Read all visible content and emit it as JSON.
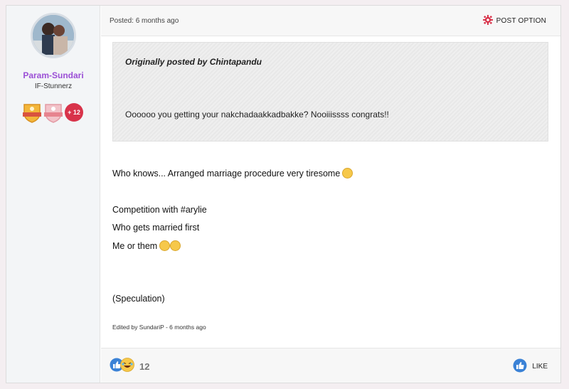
{
  "user": {
    "name": "Param-Sundari",
    "title": "IF-Stunnerz",
    "extra_badges": "+ 12"
  },
  "post": {
    "posted": "Posted: 6 months ago",
    "option_label": "POST OPTION",
    "quote": {
      "author": "Originally posted by Chintapandu",
      "text": "Oooooo you getting your nakchadaakkadbakke? Nooiiissss congrats!!"
    },
    "body": [
      "Who knows... Arranged marriage procedure very tiresome",
      "Competition with #arylie",
      "Who gets married first",
      "Me or them",
      "(Speculation)"
    ],
    "edited": "Edited by SundariP - 6 months ago"
  },
  "footer": {
    "reaction_count": "12",
    "like_label": "LIKE"
  },
  "colors": {
    "username": "#9b4fd6",
    "accent_red": "#d8334a",
    "like_blue": "#3b82d6"
  }
}
